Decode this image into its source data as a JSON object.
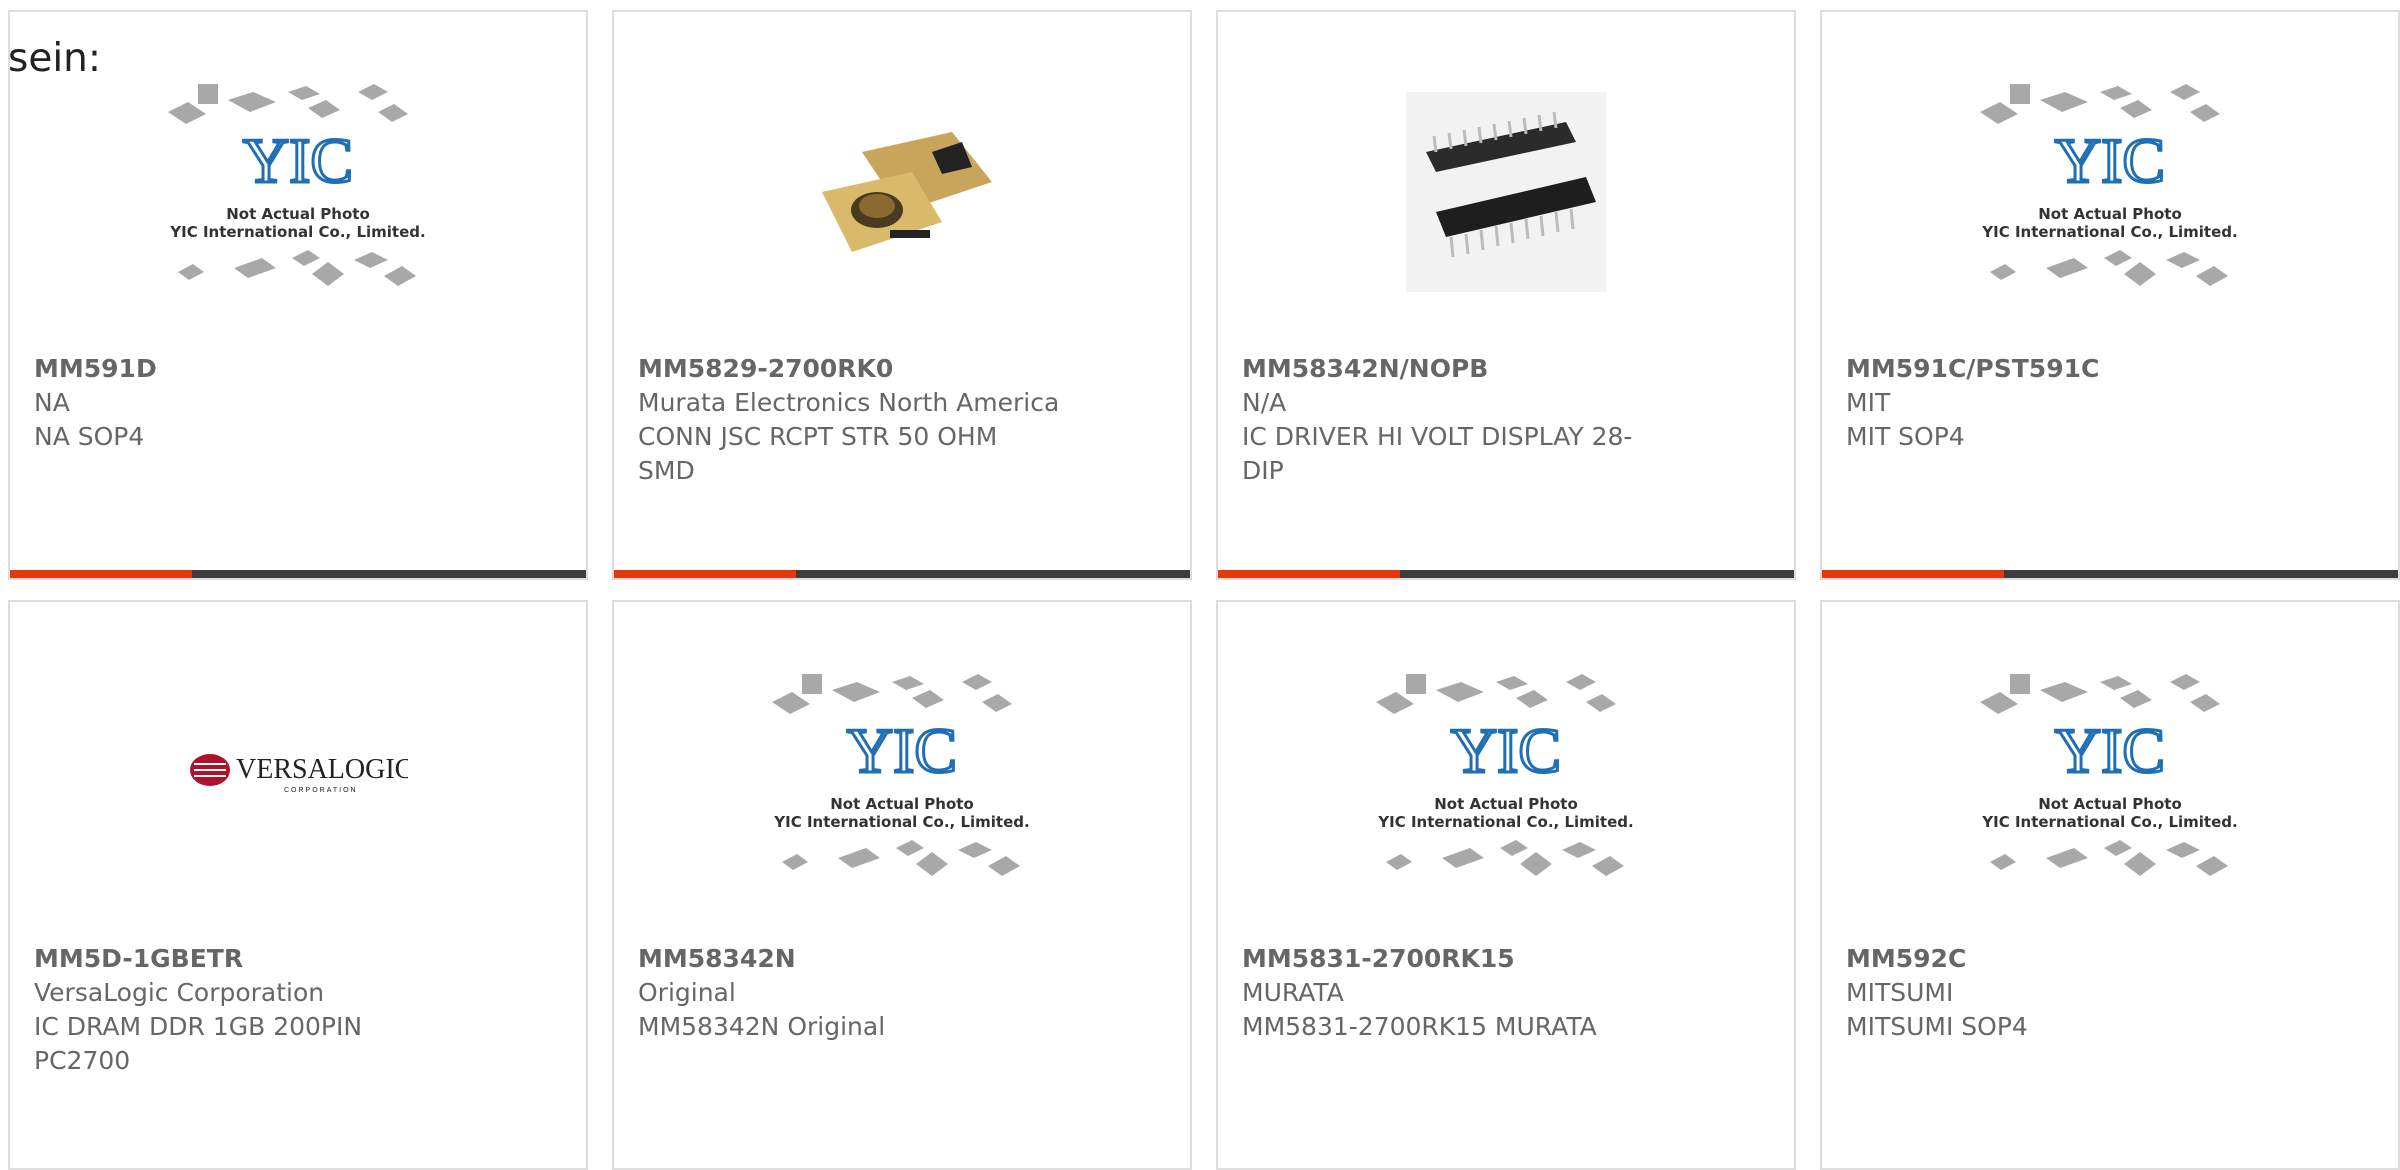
{
  "intro_text": "sein:",
  "placeholder": {
    "line1": "Not Actual Photo",
    "line2": "YIC International Co., Limited.",
    "logo": "YIC"
  },
  "versalogic_logo": {
    "text": "VERSALOGIC",
    "sub": "CORPORATION"
  },
  "colors": {
    "accent": "#e5380b",
    "bar": "#3d3d3d",
    "border": "#dddddd",
    "text": "#666666",
    "logo_blue": "#1f6fb5"
  },
  "products": [
    {
      "part": "MM591D",
      "maker": "NA",
      "desc": "NA SOP4",
      "image": "yic-placeholder"
    },
    {
      "part": "MM5829-2700RK0",
      "maker": "Murata Electronics North America",
      "desc": "CONN JSC RCPT STR 50 OHM SMD",
      "image": "rf-connector"
    },
    {
      "part": "MM58342N/NOPB",
      "maker": "N/A",
      "desc": "IC DRIVER HI VOLT DISPLAY 28-DIP",
      "image": "dip-ic"
    },
    {
      "part": "MM591C/PST591C",
      "maker": "MIT",
      "desc": "MIT SOP4",
      "image": "yic-placeholder"
    },
    {
      "part": "MM5D-1GBETR",
      "maker": "VersaLogic Corporation",
      "desc": "IC DRAM DDR 1GB 200PIN PC2700",
      "image": "versalogic-logo"
    },
    {
      "part": "MM58342N",
      "maker": "Original",
      "desc": "MM58342N Original",
      "image": "yic-placeholder"
    },
    {
      "part": "MM5831-2700RK15",
      "maker": "MURATA",
      "desc": "MM5831-2700RK15 MURATA",
      "image": "yic-placeholder"
    },
    {
      "part": "MM592C",
      "maker": "MITSUMI",
      "desc": "MITSUMI SOP4",
      "image": "yic-placeholder"
    }
  ]
}
